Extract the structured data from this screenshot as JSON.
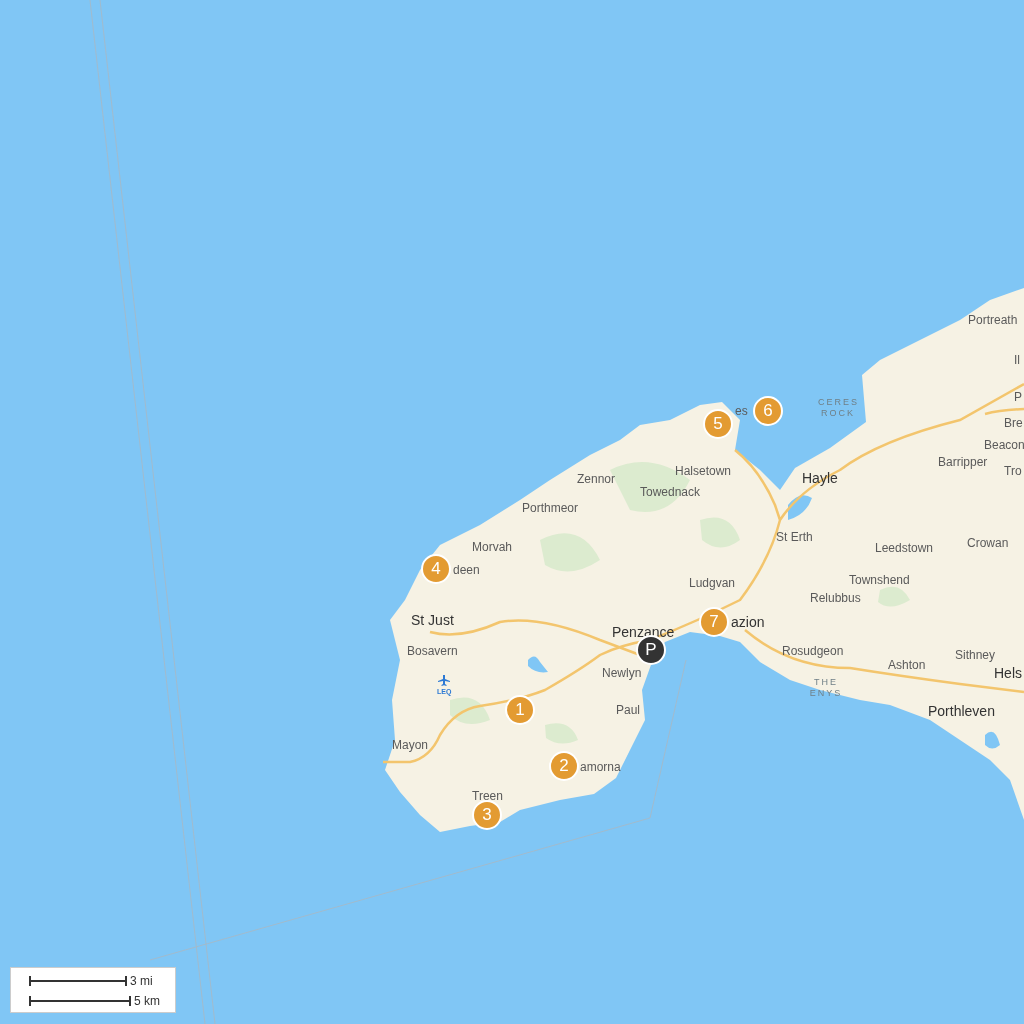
{
  "map": {
    "places": [
      {
        "name": "Portreath",
        "kind": "town"
      },
      {
        "name": "Il",
        "kind": "town"
      },
      {
        "name": "P",
        "kind": "town"
      },
      {
        "name": "es",
        "kind": "town"
      },
      {
        "name": "CERES ROCK",
        "kind": "feature"
      },
      {
        "name": "Bre",
        "kind": "town"
      },
      {
        "name": "Beacon",
        "kind": "town"
      },
      {
        "name": "Barripper",
        "kind": "town"
      },
      {
        "name": "Zennor",
        "kind": "town"
      },
      {
        "name": "Halsetown",
        "kind": "town"
      },
      {
        "name": "Hayle",
        "kind": "major"
      },
      {
        "name": "Tro",
        "kind": "town"
      },
      {
        "name": "Towednack",
        "kind": "town"
      },
      {
        "name": "Porthmeor",
        "kind": "town"
      },
      {
        "name": "Morvah",
        "kind": "town"
      },
      {
        "name": "St Erth",
        "kind": "town"
      },
      {
        "name": "Leedstown",
        "kind": "town"
      },
      {
        "name": "Crowan",
        "kind": "town"
      },
      {
        "name": "deen",
        "kind": "town"
      },
      {
        "name": "Ludgvan",
        "kind": "town"
      },
      {
        "name": "Townshend",
        "kind": "town"
      },
      {
        "name": "Relubbus",
        "kind": "town"
      },
      {
        "name": "St Just",
        "kind": "major"
      },
      {
        "name": "Penzance",
        "kind": "major"
      },
      {
        "name": "azion",
        "kind": "major"
      },
      {
        "name": "Bosavern",
        "kind": "town"
      },
      {
        "name": "Rosudgeon",
        "kind": "town"
      },
      {
        "name": "Sithney",
        "kind": "town"
      },
      {
        "name": "Newlyn",
        "kind": "town"
      },
      {
        "name": "Ashton",
        "kind": "town"
      },
      {
        "name": "Hels",
        "kind": "major"
      },
      {
        "name": "LEQ",
        "kind": "airport"
      },
      {
        "name": "THE ENYS",
        "kind": "feature"
      },
      {
        "name": "Paul",
        "kind": "town"
      },
      {
        "name": "Porthleven",
        "kind": "major"
      },
      {
        "name": "Mayon",
        "kind": "town"
      },
      {
        "name": "amorna",
        "kind": "town"
      },
      {
        "name": "Treen",
        "kind": "town"
      }
    ],
    "markers": [
      {
        "label": "1",
        "kind": "stop"
      },
      {
        "label": "2",
        "kind": "stop"
      },
      {
        "label": "3",
        "kind": "stop"
      },
      {
        "label": "4",
        "kind": "stop"
      },
      {
        "label": "5",
        "kind": "stop"
      },
      {
        "label": "6",
        "kind": "stop"
      },
      {
        "label": "7",
        "kind": "stop"
      },
      {
        "label": "P",
        "kind": "parking"
      }
    ],
    "scale_bar": {
      "imperial": "3 mi",
      "metric": "5 km"
    }
  }
}
